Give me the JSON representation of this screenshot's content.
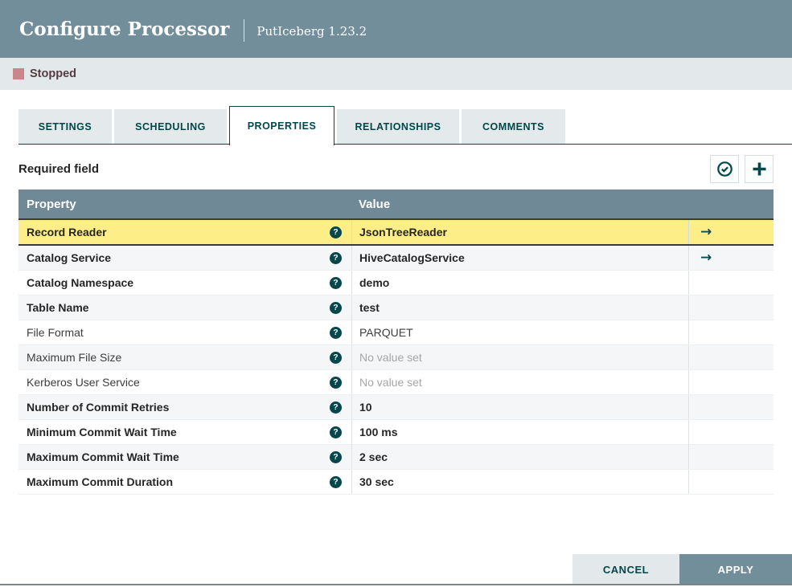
{
  "dialog": {
    "title": "Configure Processor",
    "subtitle": "PutIceberg 1.23.2"
  },
  "status": {
    "label": "Stopped"
  },
  "tabs": [
    {
      "label": "SETTINGS",
      "active": false
    },
    {
      "label": "SCHEDULING",
      "active": false
    },
    {
      "label": "PROPERTIES",
      "active": true
    },
    {
      "label": "RELATIONSHIPS",
      "active": false
    },
    {
      "label": "COMMENTS",
      "active": false
    }
  ],
  "toolbar": {
    "required_field_label": "Required field",
    "verify_icon": "check-circle-icon",
    "add_icon": "plus-icon"
  },
  "table": {
    "columns": [
      "Property",
      "Value"
    ],
    "rows": [
      {
        "property": "Record Reader",
        "value": "JsonTreeReader",
        "required": true,
        "unset": false,
        "has_goto": true,
        "selected": true
      },
      {
        "property": "Catalog Service",
        "value": "HiveCatalogService",
        "required": true,
        "unset": false,
        "has_goto": true,
        "selected": false
      },
      {
        "property": "Catalog Namespace",
        "value": "demo",
        "required": true,
        "unset": false,
        "has_goto": false,
        "selected": false
      },
      {
        "property": "Table Name",
        "value": "test",
        "required": true,
        "unset": false,
        "has_goto": false,
        "selected": false
      },
      {
        "property": "File Format",
        "value": "PARQUET",
        "required": false,
        "unset": false,
        "has_goto": false,
        "selected": false
      },
      {
        "property": "Maximum File Size",
        "value": "No value set",
        "required": false,
        "unset": true,
        "has_goto": false,
        "selected": false
      },
      {
        "property": "Kerberos User Service",
        "value": "No value set",
        "required": false,
        "unset": true,
        "has_goto": false,
        "selected": false
      },
      {
        "property": "Number of Commit Retries",
        "value": "10",
        "required": true,
        "unset": false,
        "has_goto": false,
        "selected": false
      },
      {
        "property": "Minimum Commit Wait Time",
        "value": "100 ms",
        "required": true,
        "unset": false,
        "has_goto": false,
        "selected": false
      },
      {
        "property": "Maximum Commit Wait Time",
        "value": "2 sec",
        "required": true,
        "unset": false,
        "has_goto": false,
        "selected": false
      },
      {
        "property": "Maximum Commit Duration",
        "value": "30 sec",
        "required": true,
        "unset": false,
        "has_goto": false,
        "selected": false
      }
    ]
  },
  "footer": {
    "cancel_label": "CANCEL",
    "apply_label": "APPLY"
  },
  "colors": {
    "header_bg": "#728e9b",
    "accent_teal": "#004849",
    "selected_row": "#fdee87",
    "stopped_red": "#c9868c",
    "table_header_bg": "#6f8a96",
    "status_bar_bg": "#e3e8ea"
  }
}
